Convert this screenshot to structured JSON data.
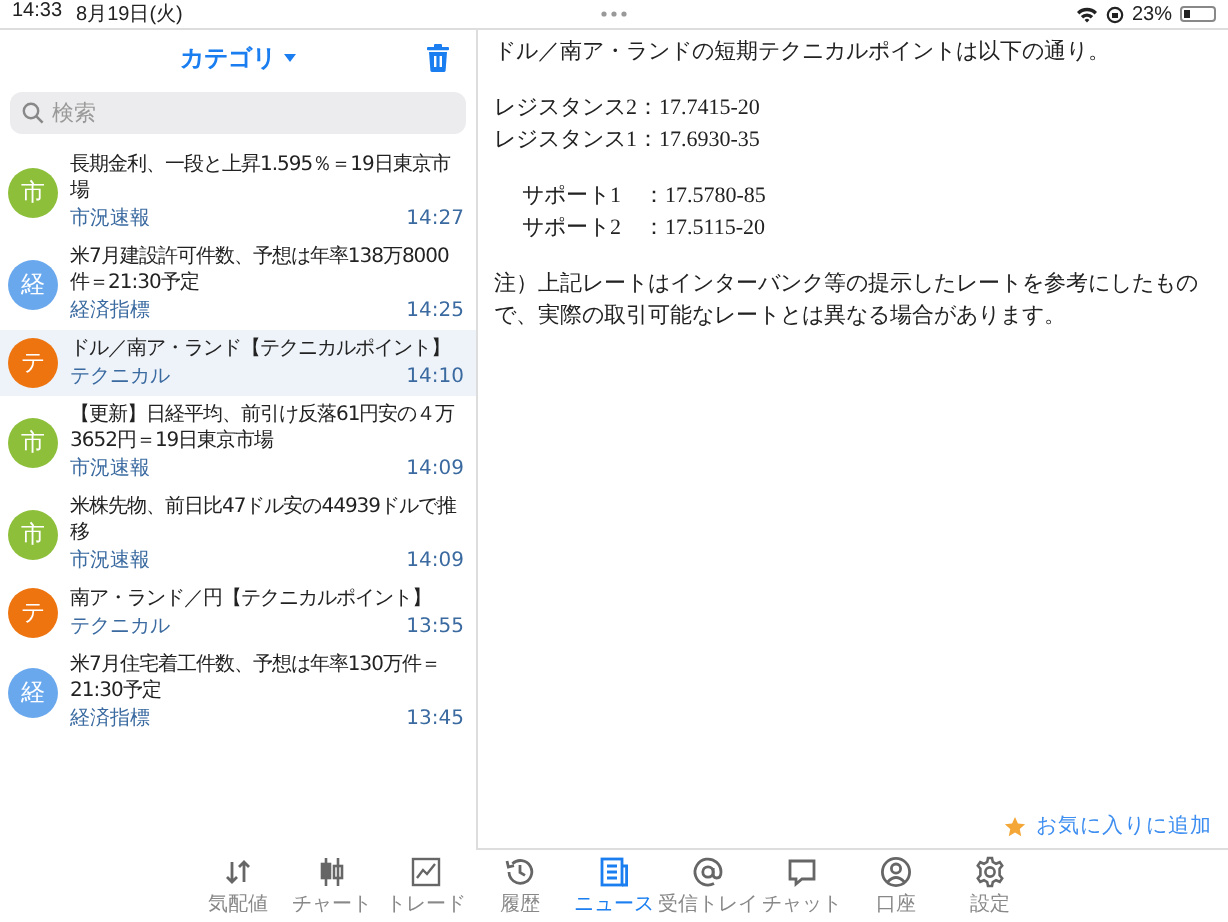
{
  "status_bar": {
    "time": "14:33",
    "date": "8月19日(火)",
    "battery": "23%"
  },
  "sidebar": {
    "title": "カテゴリ",
    "search": {
      "placeholder": "検索"
    },
    "items": [
      {
        "avatar": "市",
        "color": "#8dbf3a",
        "title": "長期金利、一段と上昇1.595％＝19日東京市場",
        "category": "市況速報",
        "time": "14:27",
        "selected": false
      },
      {
        "avatar": "経",
        "color": "#6aa8ee",
        "title": "米7月建設許可件数、予想は年率138万8000件＝21:30予定",
        "category": "経済指標",
        "time": "14:25",
        "selected": false
      },
      {
        "avatar": "テ",
        "color": "#ee7410",
        "title": "ドル／南ア・ランド【テクニカルポイント】",
        "category": "テクニカル",
        "time": "14:10",
        "selected": true
      },
      {
        "avatar": "市",
        "color": "#8dbf3a",
        "title": "【更新】日経平均、前引け反落61円安の４万3652円＝19日東京市場",
        "category": "市況速報",
        "time": "14:09",
        "selected": false
      },
      {
        "avatar": "市",
        "color": "#8dbf3a",
        "title": "米株先物、前日比47ドル安の44939ドルで推移",
        "category": "市況速報",
        "time": "14:09",
        "selected": false
      },
      {
        "avatar": "テ",
        "color": "#ee7410",
        "title": "南ア・ランド／円【テクニカルポイント】",
        "category": "テクニカル",
        "time": "13:55",
        "selected": false
      },
      {
        "avatar": "経",
        "color": "#6aa8ee",
        "title": "米7月住宅着工件数、予想は年率130万件＝21:30予定",
        "category": "経済指標",
        "time": "13:45",
        "selected": false
      }
    ]
  },
  "article": {
    "blocks": [
      {
        "kind": "para",
        "lines": [
          "ドル／南ア・ランドの短期テクニカルポイントは以下の通り。"
        ]
      },
      {
        "kind": "para",
        "lines": [
          "レジスタンス2：17.7415-20",
          "レジスタンス1：17.6930-35"
        ]
      },
      {
        "kind": "indented",
        "lines": [
          "サポート1　：17.5780-85",
          "サポート2　：17.5115-20"
        ]
      },
      {
        "kind": "para",
        "lines": [
          "注）上記レートはインターバンク等の提示したレートを参考にしたもので、実際の取引可能なレートとは異なる場合があります。"
        ]
      }
    ]
  },
  "favorite_link": "お気に入りに追加",
  "tabs": [
    {
      "label": "気配値",
      "selected": false
    },
    {
      "label": "チャート",
      "selected": false
    },
    {
      "label": "トレード",
      "selected": false
    },
    {
      "label": "履歴",
      "selected": false
    },
    {
      "label": "ニュース",
      "selected": true
    },
    {
      "label": "受信トレイ",
      "selected": false
    },
    {
      "label": "チャット",
      "selected": false
    },
    {
      "label": "口座",
      "selected": false
    },
    {
      "label": "設定",
      "selected": false
    }
  ]
}
